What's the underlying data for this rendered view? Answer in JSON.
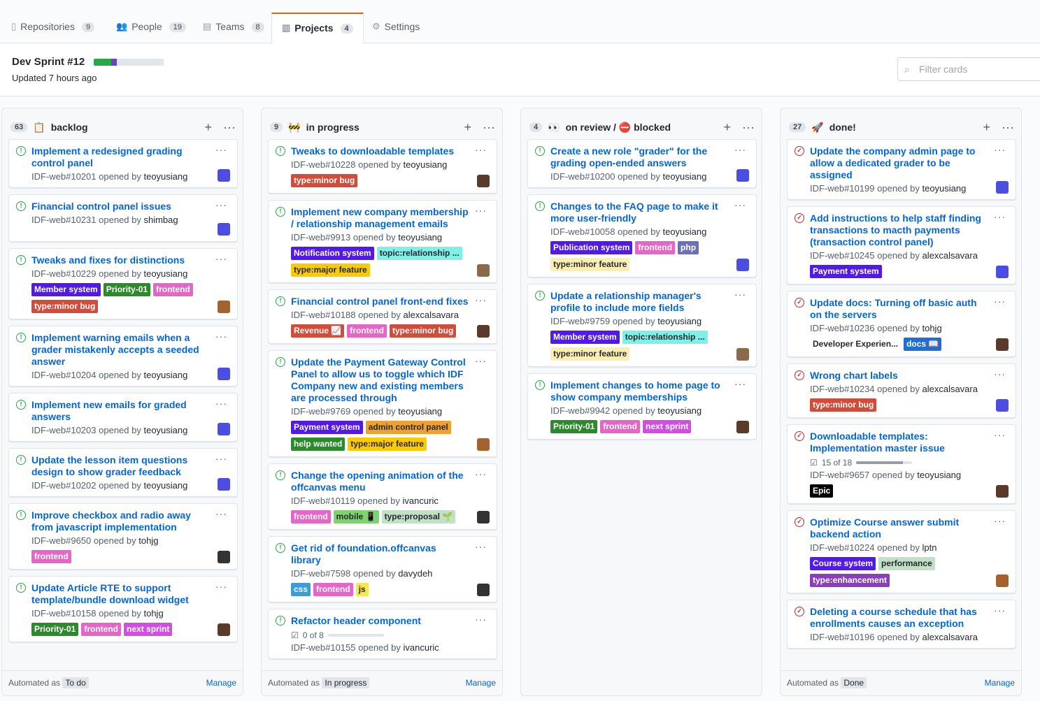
{
  "tabs": [
    {
      "label": "Repositories",
      "count": "9",
      "icon": "repo-icon",
      "glyph": "▯"
    },
    {
      "label": "People",
      "count": "19",
      "icon": "people-icon",
      "glyph": "👥"
    },
    {
      "label": "Teams",
      "count": "8",
      "icon": "team-icon",
      "glyph": "▤"
    },
    {
      "label": "Projects",
      "count": "4",
      "icon": "project-icon",
      "glyph": "▥"
    },
    {
      "label": "Settings",
      "count": "",
      "icon": "gear-icon",
      "glyph": "⚙"
    }
  ],
  "project": {
    "title": "Dev Sprint #12",
    "updated": "Updated 7 hours ago",
    "progress_done": 0.25,
    "progress_review": 0.08
  },
  "filter": {
    "placeholder": "Filter cards"
  },
  "columns": [
    {
      "count": "63",
      "emoji": "📋",
      "title": "backlog",
      "automated": "To do",
      "automated_label": "Automated as",
      "manage": "Manage",
      "cards": [
        {
          "title": "Implement a redesigned grading control panel",
          "ref": "IDF-web#10201",
          "user": "teoyusiang",
          "state": "open",
          "labels": [],
          "avatar": "#4b4ee0"
        },
        {
          "title": "Financial control panel issues",
          "ref": "IDF-web#10231",
          "user": "shimbag",
          "state": "open",
          "labels": [],
          "avatar": "#4b4ee0"
        },
        {
          "title": "Tweaks and fixes for distinctions",
          "ref": "IDF-web#10229",
          "user": "teoyusiang",
          "state": "open",
          "labels": [
            {
              "t": "Member system",
              "c": "#5319e7"
            },
            {
              "t": "Priority-01",
              "c": "#2c8a2c"
            },
            {
              "t": "frontend",
              "c": "#e466c6"
            },
            {
              "t": "type:minor bug",
              "c": "#d14d3b"
            }
          ],
          "avatar": "#a5622f"
        },
        {
          "title": "Implement warning emails when a grader mistakenly accepts a seeded answer",
          "ref": "IDF-web#10204",
          "user": "teoyusiang",
          "state": "open",
          "labels": [],
          "avatar": "#4b4ee0"
        },
        {
          "title": "Implement new emails for graded answers",
          "ref": "IDF-web#10203",
          "user": "teoyusiang",
          "state": "open",
          "labels": [],
          "avatar": "#4b4ee0"
        },
        {
          "title": "Update the lesson item questions design to show grader feedback",
          "ref": "IDF-web#10202",
          "user": "teoyusiang",
          "state": "open",
          "labels": [],
          "avatar": "#4b4ee0"
        },
        {
          "title": "Improve checkbox and radio away from javascript implementation",
          "ref": "IDF-web#9650",
          "user": "tohjg",
          "state": "open",
          "labels": [
            {
              "t": "frontend",
              "c": "#e466c6"
            }
          ],
          "avatar": "#333"
        },
        {
          "title": "Update Article RTE to support template/bundle download widget",
          "ref": "IDF-web#10158",
          "user": "tohjg",
          "state": "open",
          "labels": [
            {
              "t": "Priority-01",
              "c": "#2c8a2c"
            },
            {
              "t": "frontend",
              "c": "#e466c6"
            },
            {
              "t": "next sprint",
              "c": "#d14ee0"
            }
          ],
          "avatar": "#5a3a2a"
        }
      ]
    },
    {
      "count": "9",
      "emoji": "🚧",
      "title": "in progress",
      "automated": "In progress",
      "automated_label": "Automated as",
      "manage": "Manage",
      "cards": [
        {
          "title": "Tweaks to downloadable templates",
          "ref": "IDF-web#10228",
          "user": "teoyusiang",
          "state": "open",
          "labels": [
            {
              "t": "type:minor bug",
              "c": "#d14d3b"
            }
          ],
          "avatar": "#5a3a2a"
        },
        {
          "title": "Implement new company membership / relationship management emails",
          "ref": "IDF-web#9913",
          "user": "teoyusiang",
          "state": "open",
          "labels": [
            {
              "t": "Notification system",
              "c": "#5319e7"
            },
            {
              "t": "topic:relationship ...",
              "c": "#7ff0e8",
              "d": 1
            },
            {
              "t": "type:major feature",
              "c": "#fbca04",
              "d": 1
            }
          ],
          "avatar": "#8a6a4a"
        },
        {
          "title": "Financial control panel front-end fixes",
          "ref": "IDF-web#10188",
          "user": "alexcalsavara",
          "state": "open",
          "labels": [
            {
              "t": "Revenue 📈",
              "c": "#d14d3b"
            },
            {
              "t": "frontend",
              "c": "#e466c6"
            },
            {
              "t": "type:minor bug",
              "c": "#d14d3b"
            }
          ],
          "avatar": "#5a3a2a"
        },
        {
          "title": "Update the Payment Gateway Control Panel to allow us to toggle which IDF Company new and existing members are processed through",
          "ref": "IDF-web#9769",
          "user": "teoyusiang",
          "state": "open",
          "labels": [
            {
              "t": "Payment system",
              "c": "#5319e7"
            },
            {
              "t": "admin control panel",
              "c": "#f0a030",
              "d": 1
            },
            {
              "t": "help wanted",
              "c": "#2c8a2c"
            },
            {
              "t": "type:major feature",
              "c": "#fbca04",
              "d": 1
            }
          ],
          "avatar": "#a5622f"
        },
        {
          "title": "Change the opening animation of the offcanvas menu",
          "ref": "IDF-web#10119",
          "user": "ivancuric",
          "state": "open",
          "labels": [
            {
              "t": "frontend",
              "c": "#e466c6"
            },
            {
              "t": "mobile 📱",
              "c": "#7ed36f",
              "d": 1
            },
            {
              "t": "type:proposal 🌱",
              "c": "#c2e0c6",
              "d": 1
            }
          ],
          "avatar": "#333"
        },
        {
          "title": "Get rid of foundation.offcanvas library",
          "ref": "IDF-web#7598",
          "user": "davydeh",
          "state": "open",
          "labels": [
            {
              "t": "css",
              "c": "#3c9bd8"
            },
            {
              "t": "frontend",
              "c": "#e466c6"
            },
            {
              "t": "js",
              "c": "#f6e84a",
              "d": 1
            }
          ],
          "avatar": "#333"
        },
        {
          "title": "Refactor header component",
          "ref": "IDF-web#10155",
          "user": "ivancuric",
          "state": "open",
          "progress": "0 of 8",
          "pval": 0,
          "labels": [],
          "avatar": ""
        }
      ]
    },
    {
      "count": "4",
      "emoji": "👀",
      "title": "on review / ⛔ blocked",
      "automated": "",
      "automated_label": "",
      "manage": "",
      "cards": [
        {
          "title": "Create a new role \"grader\" for the grading open-ended answers",
          "ref": "IDF-web#10200",
          "user": "teoyusiang",
          "state": "open",
          "labels": [],
          "avatar": "#4b4ee0"
        },
        {
          "title": "Changes to the FAQ page to make it more user-friendly",
          "ref": "IDF-web#10058",
          "user": "teoyusiang",
          "state": "open",
          "labels": [
            {
              "t": "Publication system",
              "c": "#5319e7"
            },
            {
              "t": "frontend",
              "c": "#e466c6"
            },
            {
              "t": "php",
              "c": "#6a6fb8"
            },
            {
              "t": "type:minor feature",
              "c": "#fbeeb0",
              "d": 1
            }
          ],
          "avatar": "#4b4ee0"
        },
        {
          "title": "Update a relationship manager's profile to include more fields",
          "ref": "IDF-web#9759",
          "user": "teoyusiang",
          "state": "open",
          "labels": [
            {
              "t": "Member system",
              "c": "#5319e7"
            },
            {
              "t": "topic:relationship ...",
              "c": "#7ff0e8",
              "d": 1
            },
            {
              "t": "type:minor feature",
              "c": "#fbeeb0",
              "d": 1
            }
          ],
          "avatar": "#8a6a4a"
        },
        {
          "title": "Implement changes to home page to show company memberships",
          "ref": "IDF-web#9942",
          "user": "teoyusiang",
          "state": "open",
          "labels": [
            {
              "t": "Priority-01",
              "c": "#2c8a2c"
            },
            {
              "t": "frontend",
              "c": "#e466c6"
            },
            {
              "t": "next sprint",
              "c": "#d14ee0"
            }
          ],
          "avatar": "#5a3a2a"
        }
      ]
    },
    {
      "count": "27",
      "emoji": "🚀",
      "title": "done!",
      "automated": "Done",
      "automated_label": "Automated as",
      "manage": "Manage",
      "cards": [
        {
          "title": "Update the company admin page to allow a dedicated grader to be assigned",
          "ref": "IDF-web#10199",
          "user": "teoyusiang",
          "state": "closed",
          "labels": [],
          "avatar": "#4b4ee0"
        },
        {
          "title": "Add instructions to help staff finding transactions to macth payments (transaction control panel)",
          "ref": "IDF-web#10245",
          "user": "alexcalsavara",
          "state": "closed",
          "labels": [
            {
              "t": "Payment system",
              "c": "#5319e7"
            }
          ],
          "avatar": "#4b4ee0"
        },
        {
          "title": "Update docs: Turning off basic auth on the servers",
          "ref": "IDF-web#10236",
          "user": "tohjg",
          "state": "closed",
          "labels": [
            {
              "t": "Developer Experien...",
              "c": "#ffffff",
              "d": 1
            },
            {
              "t": "docs 📖",
              "c": "#1f6ed4"
            }
          ],
          "avatar": "#5a3a2a"
        },
        {
          "title": "Wrong chart labels",
          "ref": "IDF-web#10234",
          "user": "alexcalsavara",
          "state": "closed",
          "labels": [
            {
              "t": "type:minor bug",
              "c": "#d14d3b"
            }
          ],
          "avatar": "#4b4ee0"
        },
        {
          "title": "Downloadable templates: Implementation master issue",
          "ref": "IDF-web#9657",
          "user": "teoyusiang",
          "state": "closed",
          "progress": "15 of 18",
          "pval": 0.83,
          "labels": [
            {
              "t": "Epic",
              "c": "#000000"
            }
          ],
          "avatar": "#5a3a2a"
        },
        {
          "title": "Optimize Course answer submit backend action",
          "ref": "IDF-web#10224",
          "user": "lptn",
          "state": "closed",
          "labels": [
            {
              "t": "Course system",
              "c": "#5319e7"
            },
            {
              "t": "performance",
              "c": "#c2e0c6",
              "d": 1
            },
            {
              "t": "type:enhancement",
              "c": "#8a3fb8"
            }
          ],
          "avatar": "#a5622f"
        },
        {
          "title": "Deleting a course schedule that has enrollments causes an exception",
          "ref": "IDF-web#10196",
          "user": "alexcalsavara",
          "state": "closed",
          "labels": [],
          "avatar": ""
        }
      ]
    }
  ],
  "card_menu": "···",
  "add_glyph": "+",
  "opened_by": "opened by"
}
